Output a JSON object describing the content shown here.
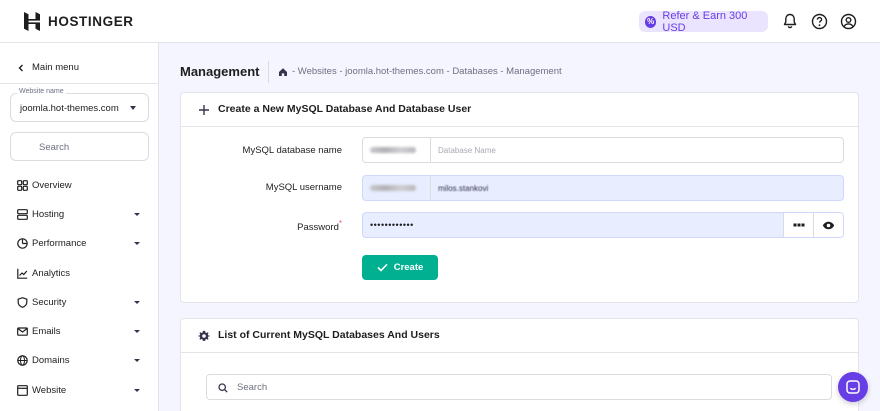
{
  "topbar": {
    "logo_text": "HOSTINGER",
    "refer_label": "Refer & Earn 300 USD",
    "icons": [
      "bell-icon",
      "help-icon",
      "account-icon"
    ]
  },
  "sidebar": {
    "main_menu_label": "Main menu",
    "website_select": {
      "label": "Website name",
      "value": "joomla.hot-themes.com"
    },
    "search_placeholder": "Search",
    "items": [
      {
        "label": "Overview",
        "icon": "overview-icon",
        "expandable": false
      },
      {
        "label": "Hosting",
        "icon": "hosting-icon",
        "expandable": true
      },
      {
        "label": "Performance",
        "icon": "performance-icon",
        "expandable": true
      },
      {
        "label": "Analytics",
        "icon": "analytics-icon",
        "expandable": false
      },
      {
        "label": "Security",
        "icon": "shield-icon",
        "expandable": true
      },
      {
        "label": "Emails",
        "icon": "mail-icon",
        "expandable": true
      },
      {
        "label": "Domains",
        "icon": "globe-icon",
        "expandable": true
      },
      {
        "label": "Website",
        "icon": "website-icon",
        "expandable": true
      }
    ]
  },
  "header": {
    "title": "Management",
    "breadcrumb": "- Websites - joomla.hot-themes.com - Databases - Management"
  },
  "create_card": {
    "title": "Create a New MySQL Database And Database User",
    "db_name": {
      "label": "MySQL database name",
      "placeholder": "Database Name",
      "value": ""
    },
    "username": {
      "label": "MySQL username",
      "value": "milos.stankovi"
    },
    "password": {
      "label": "Password",
      "value": "••••••••••••"
    },
    "create_label": "Create"
  },
  "list_card": {
    "title": "List of Current MySQL Databases And Users",
    "search_placeholder": "Search"
  },
  "colors": {
    "brand": "#673de6",
    "success": "#00b090",
    "filled_field": "#e8edff"
  }
}
